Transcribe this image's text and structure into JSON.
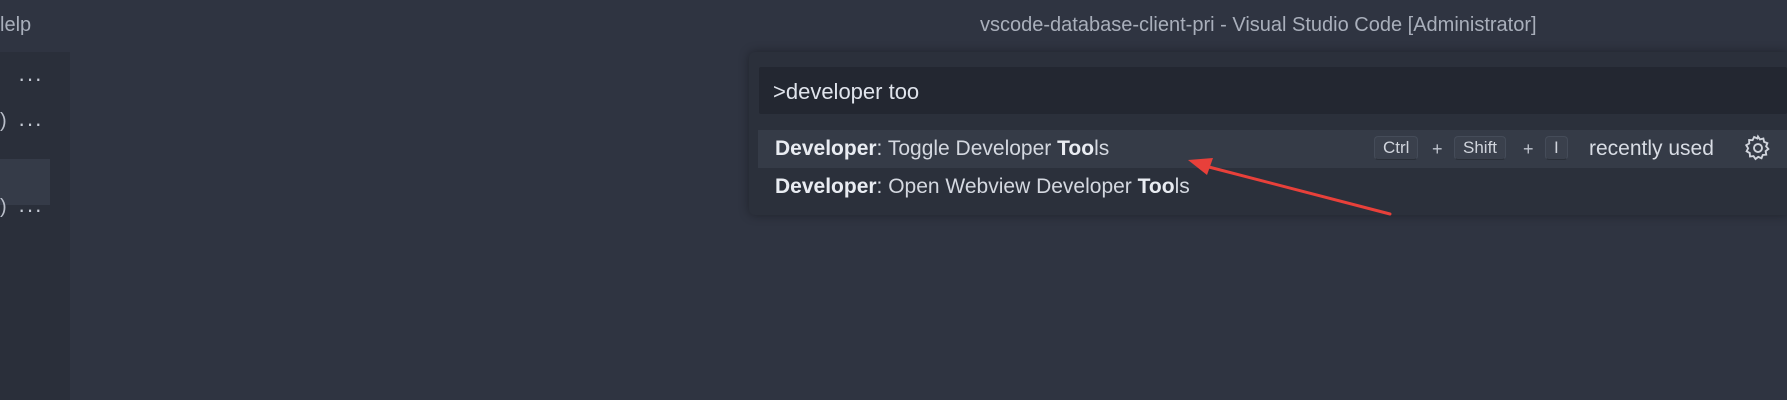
{
  "titlebar": {
    "menu_partial": "lelp",
    "window_title": "vscode-database-client-pri - Visual Studio Code [Administrator]"
  },
  "sidebar": {
    "rows": [
      {
        "prefix": "",
        "more": "···"
      },
      {
        "prefix": ")",
        "more": "···"
      },
      {
        "prefix": ")",
        "more": "···"
      }
    ]
  },
  "command_palette": {
    "input_value": ">developer too",
    "items": [
      {
        "category": "Developer",
        "sep": ": ",
        "pre": "Toggle Developer ",
        "match": "Too",
        "post": "ls",
        "keybinding": [
          "Ctrl",
          "Shift",
          "I"
        ],
        "plus": "+",
        "tag": "recently used",
        "selected": true
      },
      {
        "category": "Developer",
        "sep": ": ",
        "pre": "Open Webview Developer ",
        "match": "Too",
        "post": "ls",
        "selected": false
      }
    ]
  },
  "annotation": {
    "arrow_color": "#e8403a"
  },
  "icons": {
    "settings": "gear-icon",
    "more": "ellipsis-icon"
  },
  "colors": {
    "background": "#2f3441",
    "palette": "#2b303b",
    "selected_row": "#353b47"
  }
}
